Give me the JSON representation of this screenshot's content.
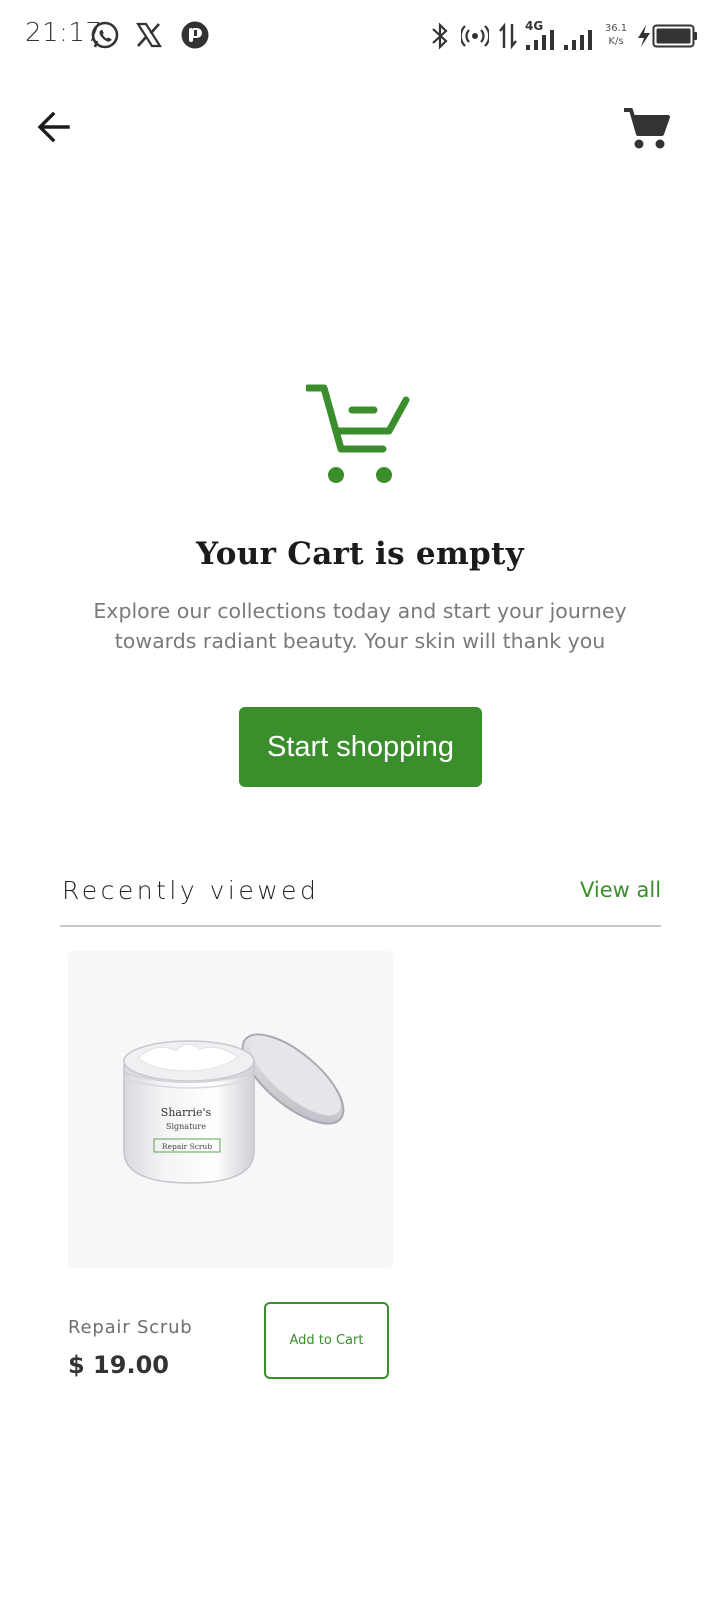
{
  "status_bar": {
    "time": "21:17",
    "speed_value": "36.1",
    "speed_unit": "K/s",
    "network": "4G",
    "icons": [
      "whatsapp-icon",
      "x-icon",
      "pinterest-like-icon",
      "bluetooth-icon",
      "hotspot-icon",
      "data-arrows-icon",
      "signal-icon",
      "signal-icon-2",
      "charging-icon",
      "battery-icon"
    ]
  },
  "app_bar": {
    "back_icon": "arrow-left-icon",
    "cart_icon": "shopping-cart-icon"
  },
  "empty_state": {
    "icon": "empty-cart-icon",
    "title": "Your Cart is empty",
    "description": "Explore our collections today and start your journey towards radiant beauty. Your skin will thank you",
    "button_label": "Start shopping"
  },
  "recently_viewed": {
    "title": "Recently viewed",
    "view_all_label": "View all",
    "items": [
      {
        "name": "Repair Scrub",
        "price": "$ 19.00",
        "add_label": "Add to Cart",
        "image_brand": "Sharrie's",
        "image_brand_sub": "Signature",
        "image_label": "Repair Scrub"
      }
    ]
  },
  "colors": {
    "accent": "#3a8f2c",
    "text_muted": "#7a7a7a"
  }
}
